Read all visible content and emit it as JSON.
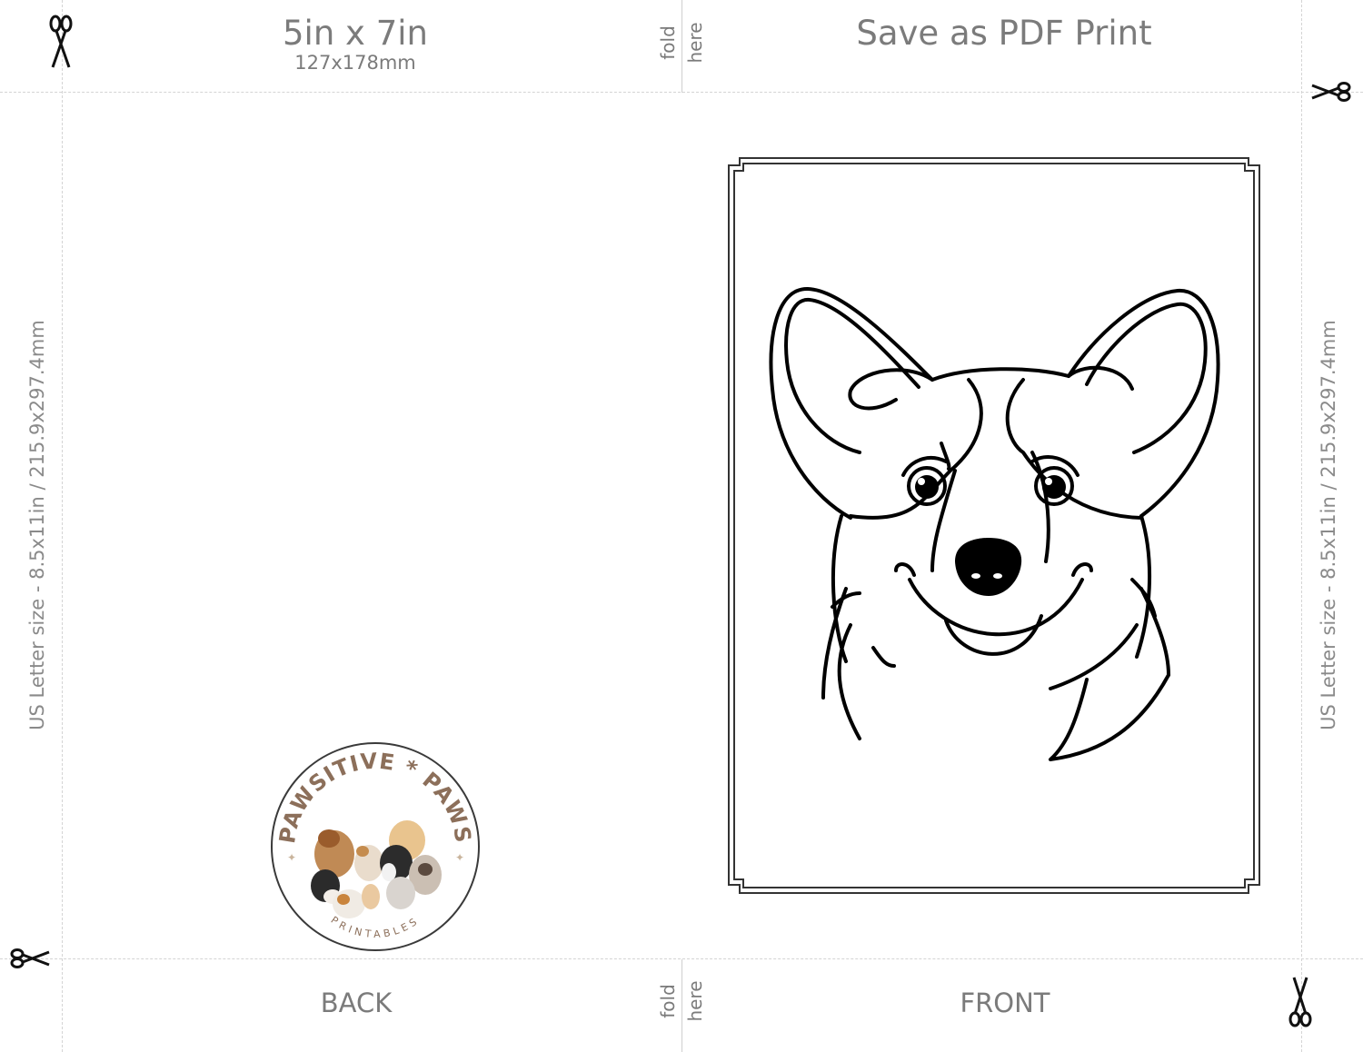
{
  "header": {
    "card_size": "5in x 7in",
    "card_size_mm": "127x178mm",
    "save_label": "Save as PDF Print"
  },
  "fold": {
    "word1": "fold",
    "word2": "here"
  },
  "side_label": "US Letter size - 8.5x11in / 215.9x297.4mm",
  "footer": {
    "back_label": "BACK",
    "front_label": "FRONT"
  },
  "logo": {
    "brand_top": "PAWSITIVE * PAWS",
    "brand_bottom": "PRINTABLES"
  },
  "icons": {
    "cut_marks": "scissors-icon",
    "illustration": "corgi-line-art"
  },
  "colors": {
    "text_gray": "#7b7b7b",
    "guide_line": "#d4d4d4",
    "logo_brown": "#8c6f5a"
  }
}
